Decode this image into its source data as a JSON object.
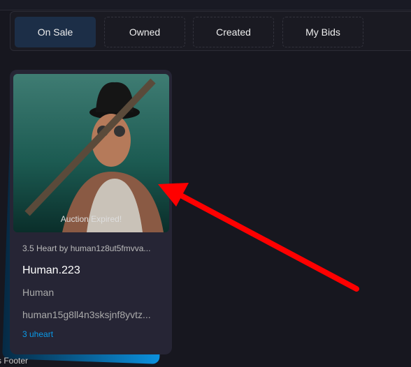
{
  "tabs": [
    {
      "label": "On Sale",
      "active": true
    },
    {
      "label": "Owned"
    },
    {
      "label": "Created"
    },
    {
      "label": "My Bids"
    }
  ],
  "card": {
    "status": "Auction Expired!",
    "meta": "3.5 Heart by human1z8ut5fmvva...",
    "title": "Human.223",
    "collection": "Human",
    "owner": "human15g8ll4n3sksjnf8yvtz...",
    "price": "3 uheart"
  },
  "footer": "s Footer",
  "colors": {
    "accent": "#0a9ae8",
    "arrow": "#ff0000"
  }
}
